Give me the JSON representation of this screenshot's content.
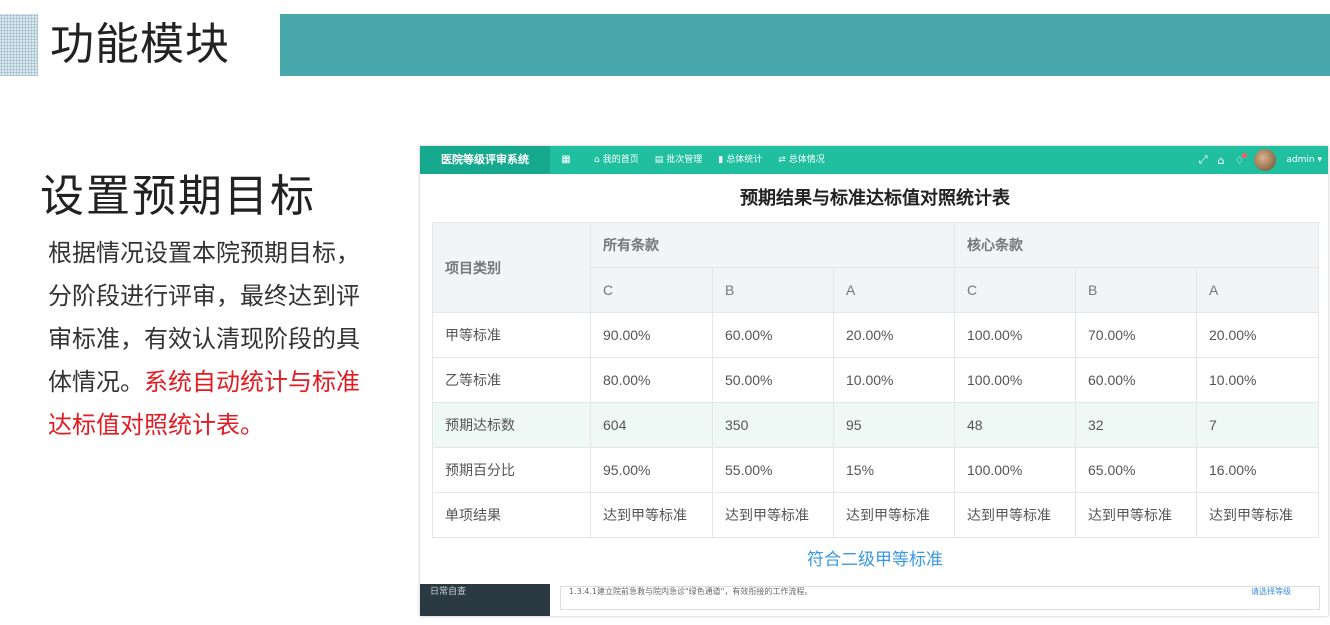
{
  "header": {
    "title": "功能模块",
    "accent_color": "#48a8ab"
  },
  "section": {
    "title": "设置预期目标",
    "description": "根据情况设置本院预期目标，分阶段进行评审，最终达到评审标准，有效认清现阶段的具体情况。",
    "highlight": "系统自动统计与标准达标值对照统计表。",
    "highlight_color": "#e31b23"
  },
  "app": {
    "name": "医院等级评审系统",
    "nav": [
      {
        "icon": "home-icon",
        "label": "我的首页"
      },
      {
        "icon": "list-icon",
        "label": "批次管理"
      },
      {
        "icon": "bar-chart-icon",
        "label": "总体统计"
      },
      {
        "icon": "share-icon",
        "label": "总体情况"
      }
    ],
    "user": "admin",
    "theme_color": "#1fbfa0"
  },
  "table": {
    "title": "预期结果与标准达标值对照统计表",
    "row_header_label": "项目类别",
    "groups": [
      "所有条款",
      "核心条款"
    ],
    "subheaders": [
      "C",
      "B",
      "A",
      "C",
      "B",
      "A"
    ],
    "rows": [
      {
        "label": "甲等标准",
        "values": [
          "90.00%",
          "60.00%",
          "20.00%",
          "100.00%",
          "70.00%",
          "20.00%"
        ]
      },
      {
        "label": "乙等标准",
        "values": [
          "80.00%",
          "50.00%",
          "10.00%",
          "100.00%",
          "60.00%",
          "10.00%"
        ]
      },
      {
        "label": "预期达标数",
        "values": [
          "604",
          "350",
          "95",
          "48",
          "32",
          "7"
        ]
      },
      {
        "label": "预期百分比",
        "values": [
          "95.00%",
          "55.00%",
          "15%",
          "100.00%",
          "65.00%",
          "16.00%"
        ]
      },
      {
        "label": "单项结果",
        "values": [
          "达到甲等标准",
          "达到甲等标准",
          "达到甲等标准",
          "达到甲等标准",
          "达到甲等标准",
          "达到甲等标准"
        ]
      }
    ],
    "conclusion": "符合二级甲等标准"
  },
  "background": {
    "sidebar_label": "日常自查",
    "row_text": "1.3.4.1建立院前急救与院内急诊\"绿色通道\"，有效衔接的工作流程。",
    "select_text": "请选择等级"
  }
}
